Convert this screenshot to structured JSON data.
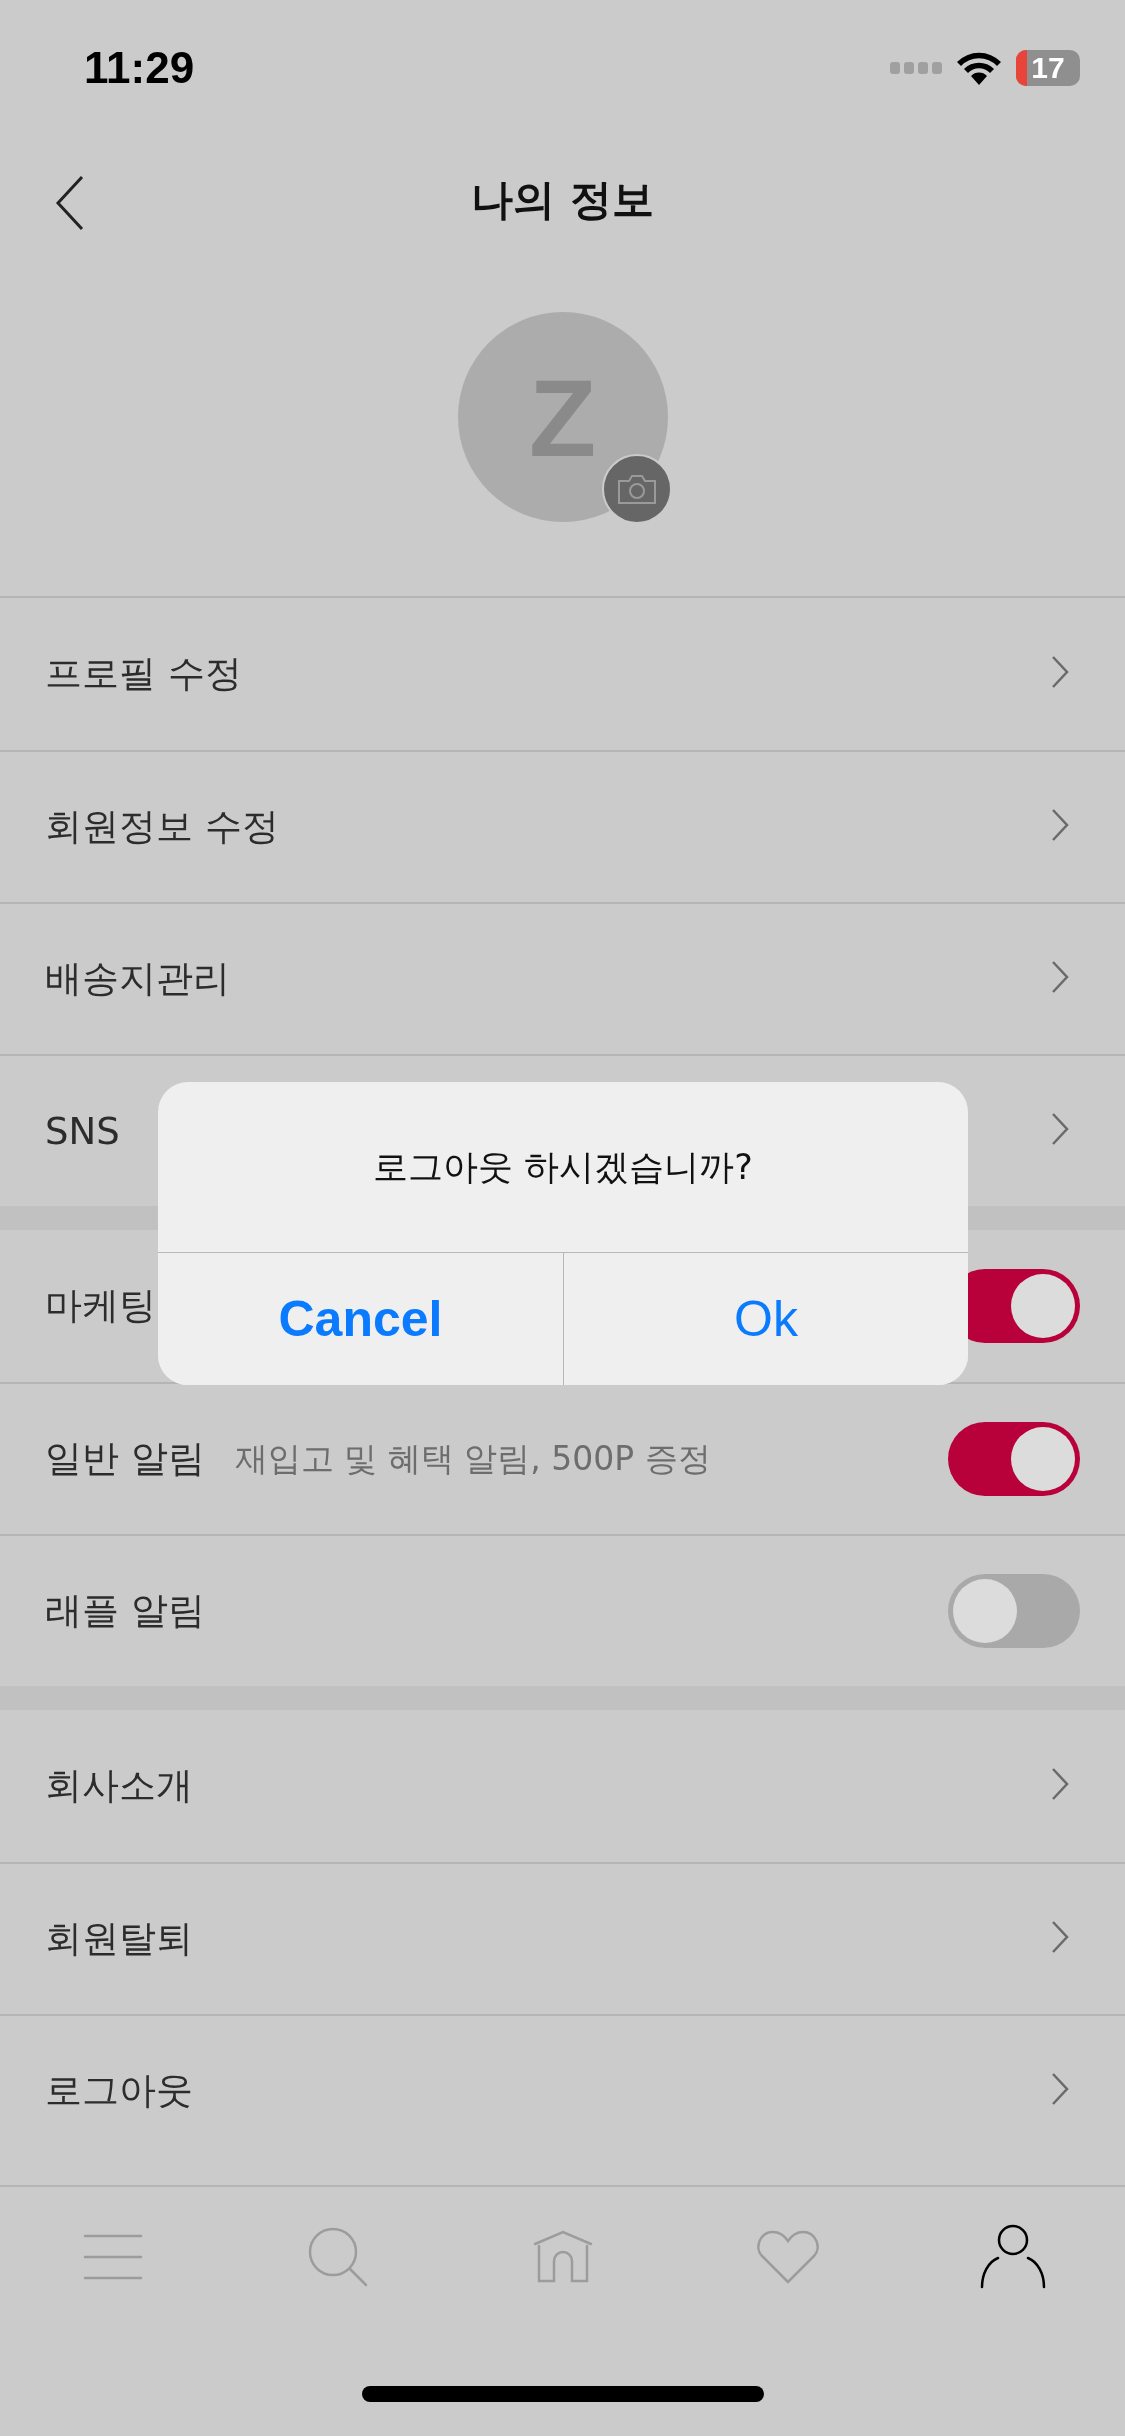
{
  "status_bar": {
    "time": "11:29",
    "battery": "17"
  },
  "header": {
    "title": "나의 정보"
  },
  "profile": {
    "initial": "Z"
  },
  "sections": [
    {
      "rows": [
        {
          "kind": "link",
          "label": "프로필 수정"
        },
        {
          "kind": "link",
          "label": "회원정보 수정"
        },
        {
          "kind": "link",
          "label": "배송지관리"
        },
        {
          "kind": "link",
          "label": "SNS"
        }
      ]
    },
    {
      "rows": [
        {
          "kind": "toggle",
          "label": "마케팅",
          "on": true
        },
        {
          "kind": "toggle",
          "label": "일반 알림",
          "note": "재입고 및 혜택 알림, 500P 증정",
          "on": true
        },
        {
          "kind": "toggle",
          "label": "래플 알림",
          "on": false
        }
      ]
    },
    {
      "rows": [
        {
          "kind": "link",
          "label": "회사소개"
        },
        {
          "kind": "link",
          "label": "회원탈퇴"
        },
        {
          "kind": "link",
          "label": "로그아웃"
        }
      ]
    }
  ],
  "dialog": {
    "message": "로그아웃 하시겠습니까?",
    "buttons": [
      {
        "label": "Cancel",
        "kind": "cancel"
      },
      {
        "label": "Ok",
        "kind": "default"
      }
    ]
  },
  "tab_bar": [
    {
      "kind": "menu",
      "selected": false
    },
    {
      "kind": "search",
      "selected": false
    },
    {
      "kind": "home",
      "selected": false
    },
    {
      "kind": "heart",
      "selected": false
    },
    {
      "kind": "person",
      "selected": true
    }
  ]
}
